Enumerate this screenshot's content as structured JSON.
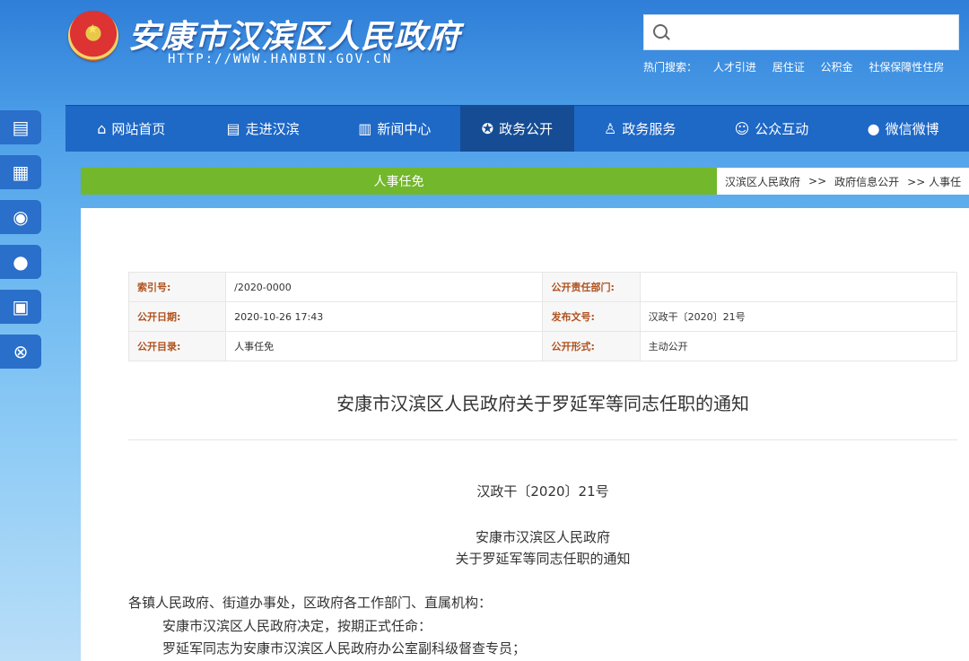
{
  "header": {
    "site_title": "安康市汉滨区人民政府",
    "site_url": "HTTP://WWW.HANBIN.GOV.CN",
    "search": {
      "placeholder": ""
    },
    "hot_label": "热门搜索：",
    "hot_items": [
      "人才引进",
      "居住证",
      "公积金",
      "社保保障性住房"
    ]
  },
  "floatbar": [
    "document-icon",
    "notes-icon",
    "weibo-icon",
    "wechat-icon",
    "app-icon",
    "close-icon"
  ],
  "nav": [
    {
      "label": "网站首页",
      "icon": "home-icon"
    },
    {
      "label": "走进汉滨",
      "icon": "document-icon"
    },
    {
      "label": "新闻中心",
      "icon": "news-icon"
    },
    {
      "label": "政务公开",
      "icon": "star-icon",
      "active": true
    },
    {
      "label": "政务服务",
      "icon": "user-icon"
    },
    {
      "label": "公众互动",
      "icon": "chat-icon"
    },
    {
      "label": "微信微博",
      "icon": "wechat-icon"
    }
  ],
  "section_title": "人事任免",
  "breadcrumb": [
    "汉滨区人民政府",
    ">>",
    "政府信息公开",
    ">> 人事任"
  ],
  "meta": {
    "rows": [
      [
        {
          "k": "索引号:",
          "v": "/2020-0000"
        },
        {
          "k": "公开责任部门:",
          "v": ""
        }
      ],
      [
        {
          "k": "公开日期:",
          "v": "2020-10-26 17:43"
        },
        {
          "k": "发布文号:",
          "v": "汉政干〔2020〕21号"
        }
      ],
      [
        {
          "k": "公开目录:",
          "v": "人事任免"
        },
        {
          "k": "公开形式:",
          "v": "主动公开"
        }
      ]
    ]
  },
  "doc": {
    "title": "安康市汉滨区人民政府关于罗延军等同志任职的通知",
    "number": "汉政干〔2020〕21号",
    "issuer": "安康市汉滨区人民政府",
    "subtitle": "关于罗延军等同志任职的通知",
    "salutation": "各镇人民政府、街道办事处，区政府各工作部门、直属机构：",
    "para1": "安康市汉滨区人民政府决定，按期正式任命：",
    "para2": "罗延军同志为安康市汉滨区人民政府办公室副科级督查专员；"
  }
}
